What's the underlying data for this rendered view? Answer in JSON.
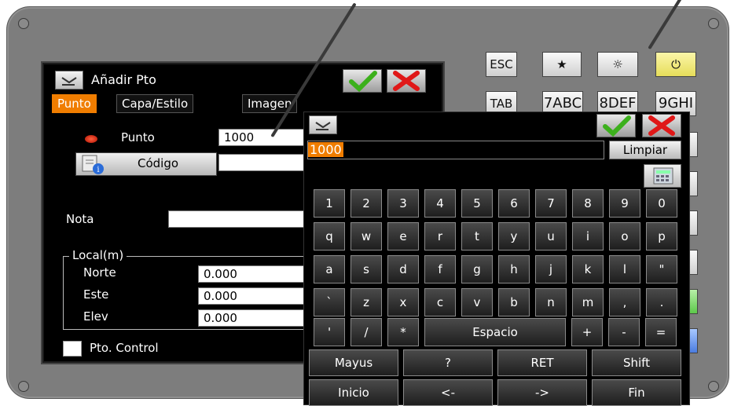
{
  "main_window": {
    "title": "Añadir Pto",
    "tabs": [
      "Punto",
      "Capa/Estilo",
      "Imagen"
    ],
    "punto_label": "Punto",
    "punto_value": "1000",
    "codigo_label": "Código",
    "codigo_value": "",
    "nota_label": "Nota",
    "nota_value": "",
    "local_group_label": "Local(m)",
    "fields": [
      {
        "label": "Norte",
        "value": "0.000"
      },
      {
        "label": "Este",
        "value": "0.000"
      },
      {
        "label": "Elev",
        "value": "0.000"
      }
    ],
    "control_label": "Pto. Control"
  },
  "hardware_keys": {
    "row1": [
      "ESC",
      "★",
      "☼",
      "⏻"
    ],
    "row2": [
      "TAB",
      "7ABC",
      "8DEF",
      "9GHI"
    ]
  },
  "keyboard": {
    "input_value": "1000",
    "clear_label": "Limpiar",
    "rows": [
      [
        "1",
        "2",
        "3",
        "4",
        "5",
        "6",
        "7",
        "8",
        "9",
        "0"
      ],
      [
        "q",
        "w",
        "e",
        "r",
        "t",
        "y",
        "u",
        "i",
        "o",
        "p"
      ],
      [
        "a",
        "s",
        "d",
        "f",
        "g",
        "h",
        "j",
        "k",
        "l",
        "\""
      ],
      [
        "`",
        "z",
        "x",
        "c",
        "v",
        "b",
        "n",
        "m",
        ",",
        "."
      ],
      [
        "'",
        "/",
        "*",
        "Espacio",
        "+",
        "-",
        "="
      ]
    ],
    "bottom_row1": [
      "Mayus",
      "?",
      "RET",
      "Shift"
    ],
    "bottom_row2": [
      "Inicio",
      "<-",
      "->",
      "Fin"
    ]
  },
  "colors": {
    "accent": "#f07d00",
    "ok": "#3cb01c",
    "cancel": "#e01818",
    "bezel": "#7d7d7d"
  }
}
